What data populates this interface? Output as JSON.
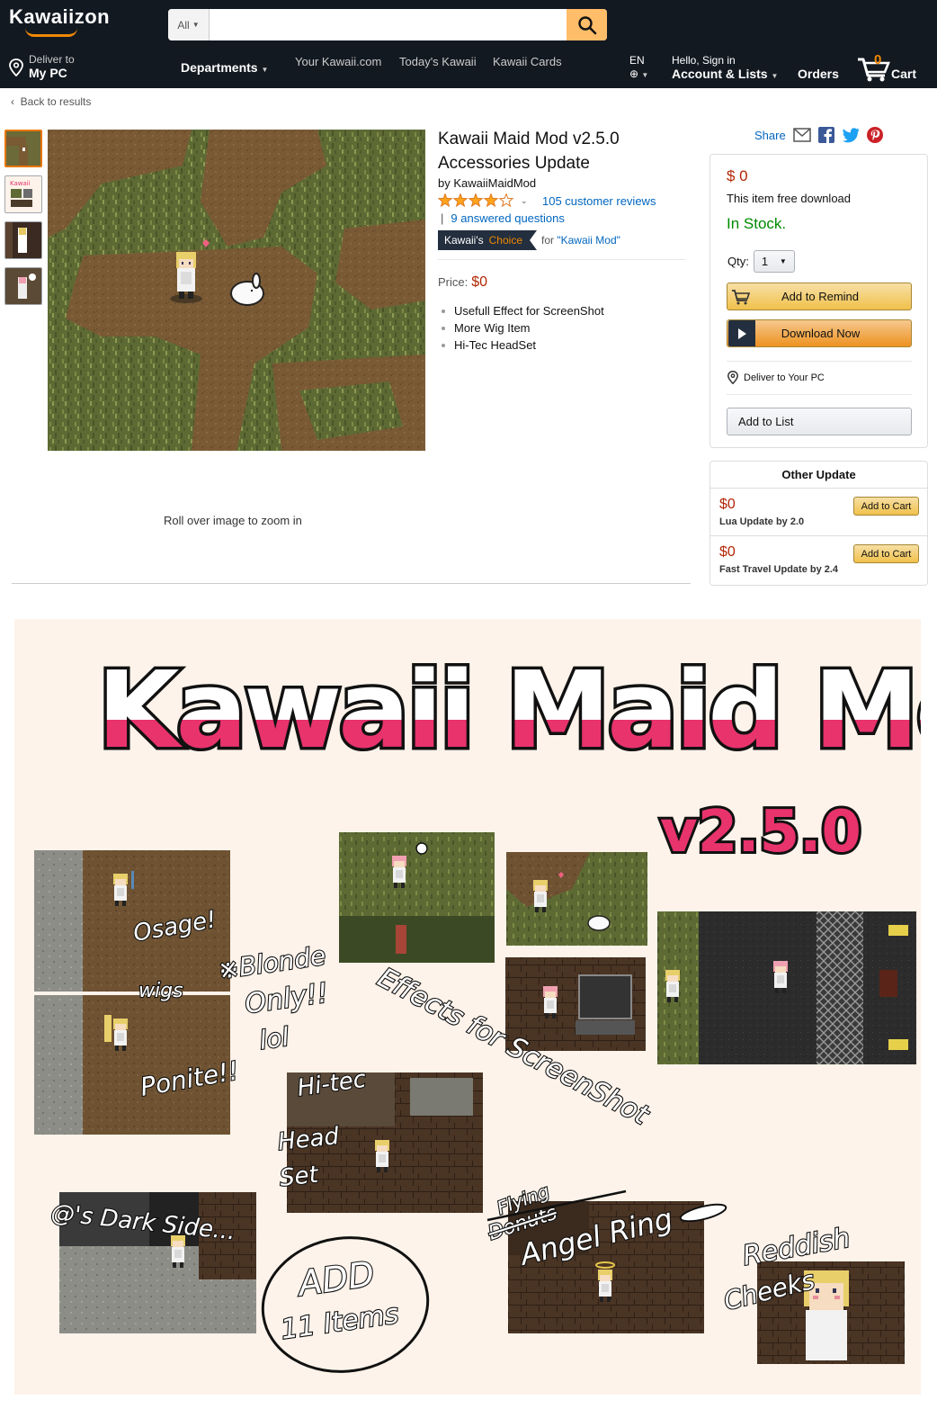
{
  "header": {
    "logo": "Kawaiizon",
    "search_category": "All",
    "search_placeholder": "",
    "deliver_line1": "Deliver to",
    "deliver_line2": "My PC",
    "departments": "Departments",
    "nav_links": [
      "Your Kawaii.com",
      "Today's Kawaii",
      "Kawaii Cards"
    ],
    "language": "EN",
    "account_line1": "Hello, Sign in",
    "account_line2": "Account & Lists",
    "orders": "Orders",
    "cart_count": "0",
    "cart_label": "Cart"
  },
  "back_link": "Back to results",
  "product": {
    "title": "Kawaii Maid Mod v2.5.0 Accessories Update",
    "byline": "by KawaiiMaidMod",
    "rating": 4,
    "reviews": "105 customer reviews",
    "answered": "9 answered questions",
    "choice_brand": "Kawaii's",
    "choice_label": "Choice",
    "choice_for_prefix": "for",
    "choice_for_term": "\"Kawaii Mod\"",
    "price_label": "Price:",
    "price_value": "$0",
    "bullets": [
      "Usefull Effect for ScreenShot",
      "More Wig Item",
      "Hi-Tec HeadSet"
    ],
    "rollover": "Roll over image to zoom in"
  },
  "buybox": {
    "share": "Share",
    "price": "$ 0",
    "free_text": "This item free download",
    "stock": "In Stock.",
    "qty_label": "Qty:",
    "qty_value": "1",
    "remind": "Add to Remind",
    "download": "Download Now",
    "deliver": "Deliver to Your PC",
    "add_list": "Add to List"
  },
  "other_update": {
    "title": "Other Update",
    "items": [
      {
        "price": "$0",
        "name": "Lua Update by 2.0",
        "button": "Add to Cart"
      },
      {
        "price": "$0",
        "name": "Fast Travel Update by 2.4",
        "button": "Add to Cart"
      }
    ]
  },
  "banner": {
    "title": "Kawaii Maid Mod",
    "version": "v2.5.0",
    "notes": {
      "osage": "Osage!",
      "wigs": "wigs",
      "blonde1": "※Blonde",
      "blonde2": "Only!!",
      "blonde3": "lol",
      "ponite": "Ponite!!",
      "effects": "Effects for ScreenShot",
      "hitec": "Hi-tec",
      "head": "Head",
      "set": "Set",
      "darkside": "@'s Dark Side...",
      "flying": "Flying",
      "donuts": "Donuts",
      "angel": "Angel Ring",
      "reddish": "Reddish",
      "cheeks": "Cheeks",
      "add": "ADD",
      "items": "11 Items"
    }
  },
  "colors": {
    "nav_bg": "#131921",
    "accent": "#f08804",
    "link": "#0066c0",
    "price": "#b12704",
    "stock": "#008a00",
    "banner_bg": "#fdf3ea",
    "title_pink": "#e8336d"
  }
}
